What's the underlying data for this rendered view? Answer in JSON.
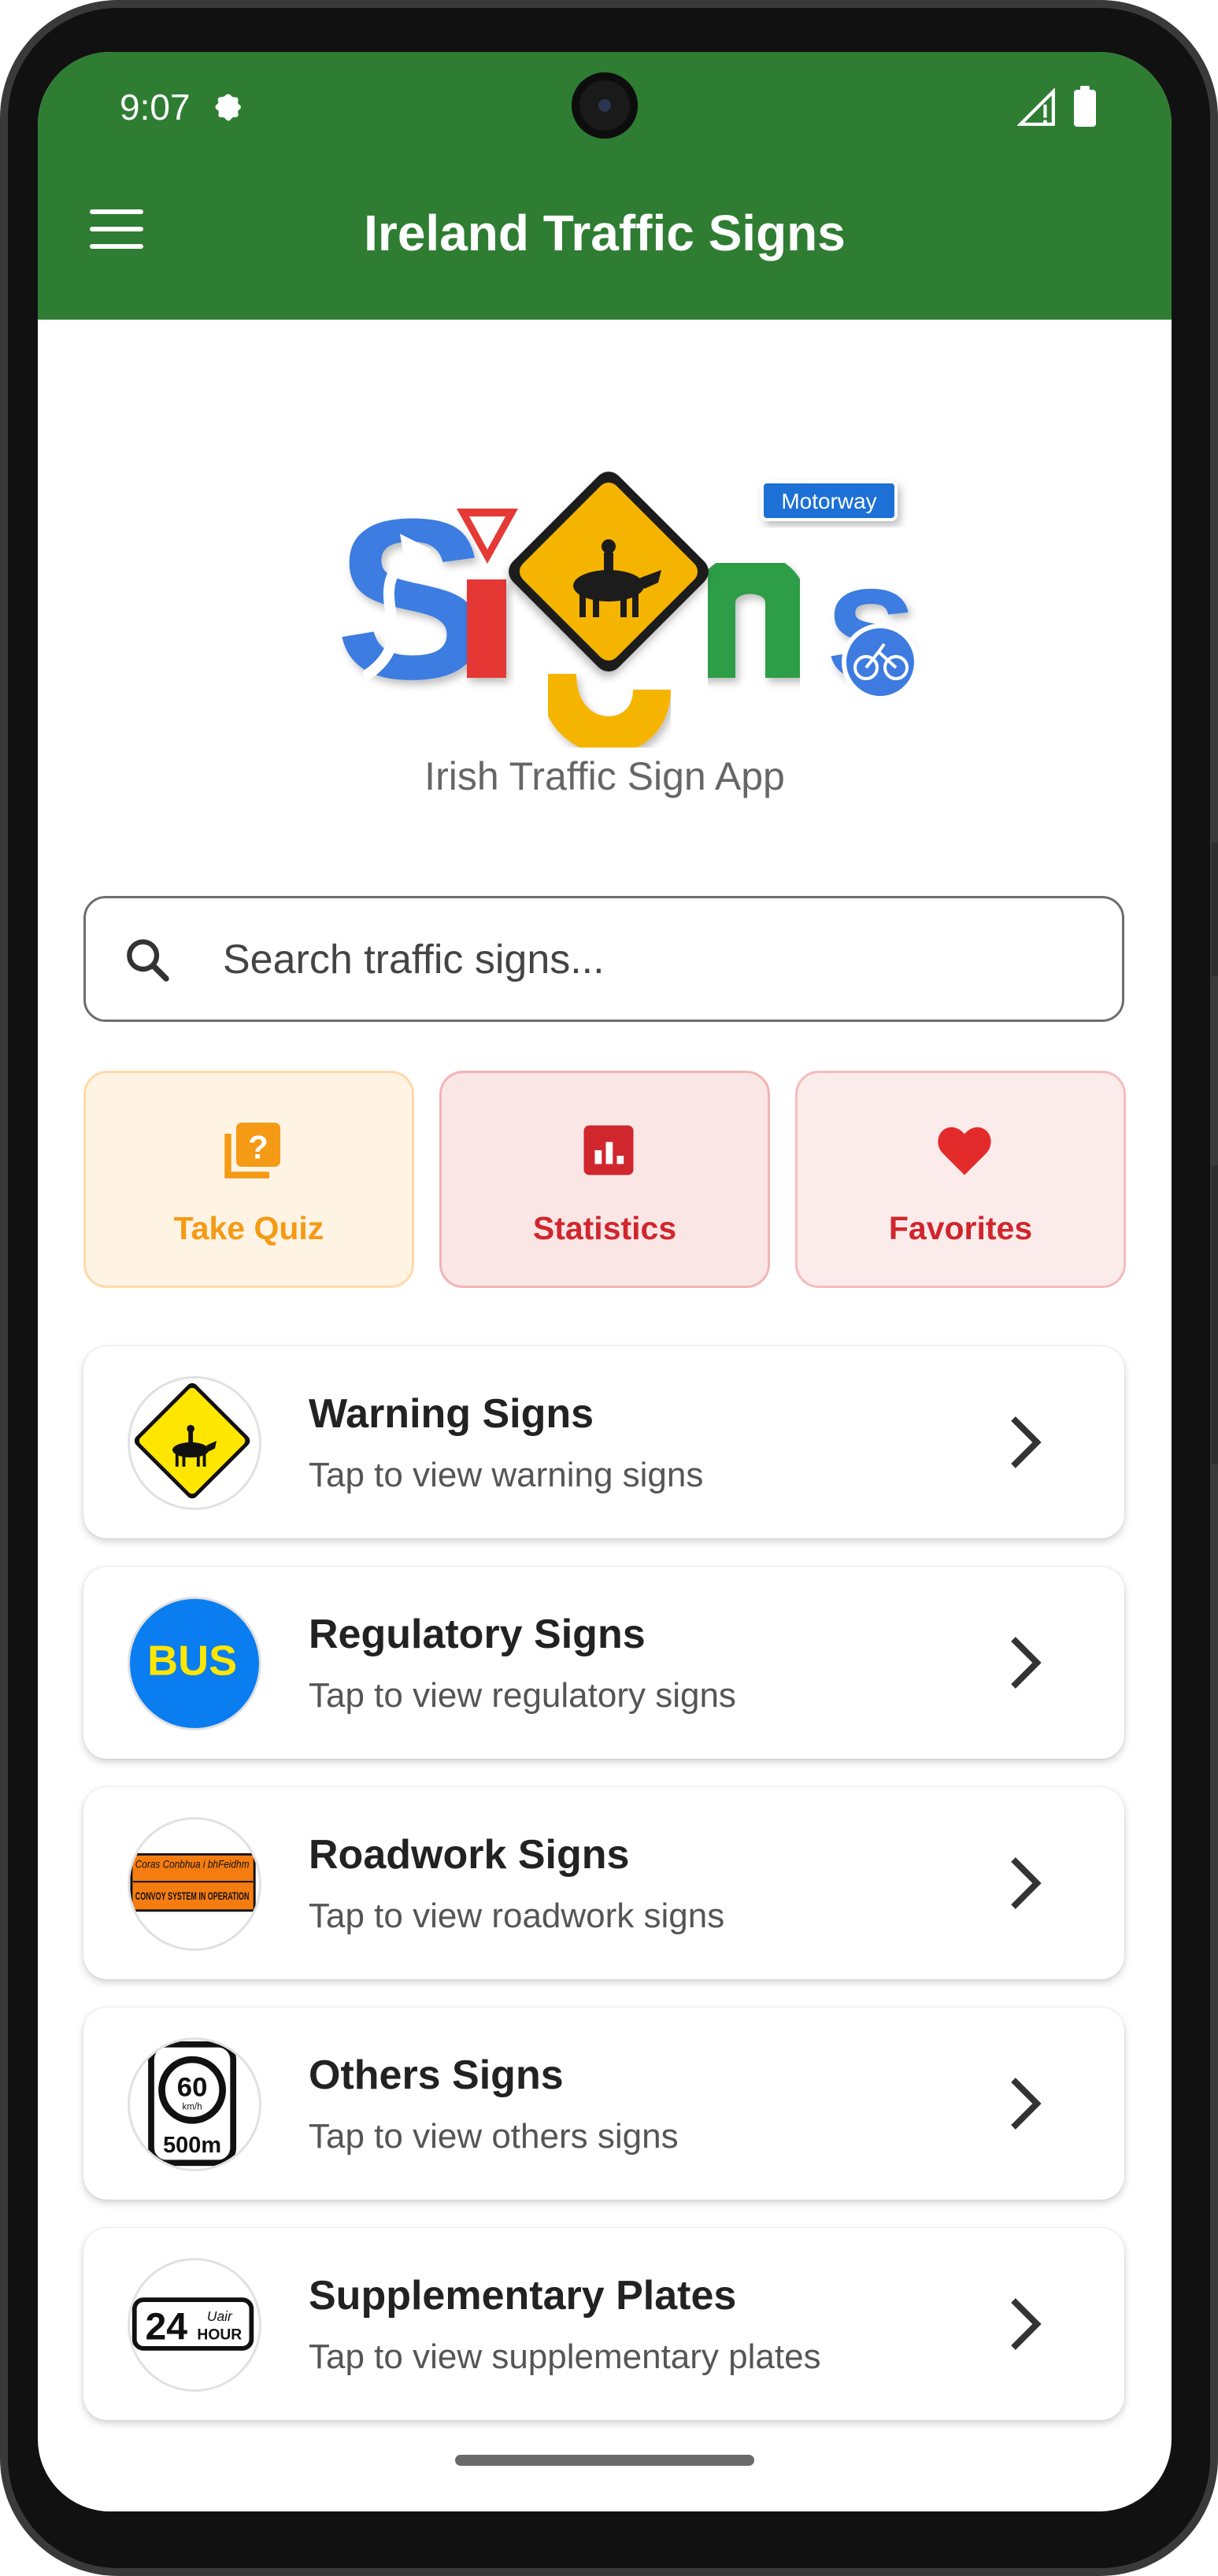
{
  "status_bar": {
    "time": "9:07"
  },
  "app_bar": {
    "title": "Ireland Traffic Signs"
  },
  "logo": {
    "tagline": "Irish Traffic Sign App",
    "motorway_label": "Motorway",
    "brand_colors": [
      "#3d7be0",
      "#e53935",
      "#f5b400",
      "#2e9d47"
    ]
  },
  "search": {
    "placeholder": "Search traffic signs..."
  },
  "quick_actions": [
    {
      "label": "Take Quiz",
      "icon": "quiz-icon",
      "color": "#f59a14"
    },
    {
      "label": "Statistics",
      "icon": "bar-chart-icon",
      "color": "#d0262d"
    },
    {
      "label": "Favorites",
      "icon": "heart-icon",
      "color": "#d0262d"
    }
  ],
  "categories": [
    {
      "title": "Warning Signs",
      "subtitle": "Tap to view warning signs",
      "icon": "horse-rider-warning-sign"
    },
    {
      "title": "Regulatory Signs",
      "subtitle": "Tap to view regulatory signs",
      "icon": "bus-sign",
      "icon_text": "BUS"
    },
    {
      "title": "Roadwork Signs",
      "subtitle": "Tap to view roadwork signs",
      "icon": "convoy-system-sign",
      "icon_text_1": "Coras Conbhua i bhFeidhm",
      "icon_text_2": "CONVOY SYSTEM IN OPERATION"
    },
    {
      "title": "Others Signs",
      "subtitle": "Tap to view others signs",
      "icon": "speed-limit-60-sign",
      "icon_text_1": "60",
      "icon_text_2": "km/h",
      "icon_text_3": "500m"
    },
    {
      "title": "Supplementary Plates",
      "subtitle": "Tap to view supplementary plates",
      "icon": "24-hour-plate",
      "icon_text_1": "24",
      "icon_text_2": "Uair",
      "icon_text_3": "HOUR"
    }
  ],
  "colors": {
    "app_bar": "#2e7d32",
    "card_bg": "#ffffff"
  }
}
